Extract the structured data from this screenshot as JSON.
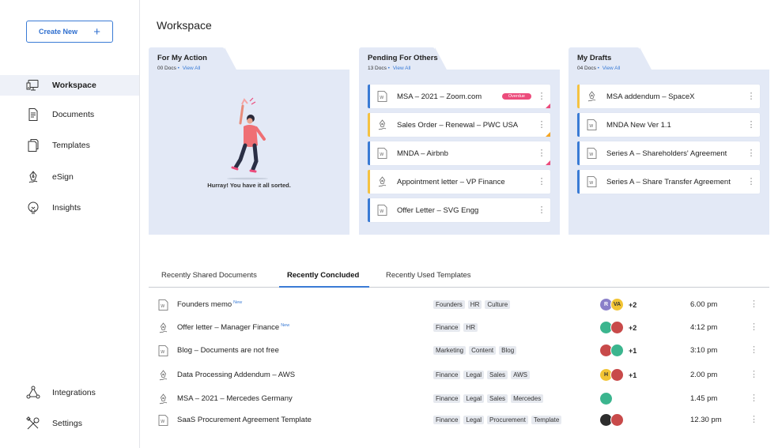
{
  "sidebar": {
    "create_label": "Create New",
    "create_icon": "plus-icon",
    "nav_top": [
      {
        "label": "Workspace",
        "icon": "monitor-icon",
        "active": true
      },
      {
        "label": "Documents",
        "icon": "document-icon",
        "active": false
      },
      {
        "label": "Templates",
        "icon": "templates-icon",
        "active": false
      },
      {
        "label": "eSign",
        "icon": "pen-nib-icon",
        "active": false
      },
      {
        "label": "Insights",
        "icon": "lightbulb-icon",
        "active": false
      }
    ],
    "nav_bottom": [
      {
        "label": "Integrations",
        "icon": "integrations-icon"
      },
      {
        "label": "Settings",
        "icon": "settings-tools-icon"
      }
    ]
  },
  "header": {
    "title": "Workspace"
  },
  "panels": {
    "my_action": {
      "title": "For My Action",
      "count": "00 Docs",
      "sep": "•",
      "view_all": "View All",
      "empty_text": "Hurray! You have it all sorted."
    },
    "pending": {
      "title": "Pending For Others",
      "count": "13 Docs",
      "sep": "•",
      "view_all": "View All",
      "docs": [
        {
          "name": "MSA – 2021 – Zoom.com",
          "icon": "word-doc-icon",
          "border": "blue",
          "badge": "Overdue",
          "corner": "pink"
        },
        {
          "name": "Sales Order – Renewal – PWC USA",
          "icon": "pen-nib-icon",
          "border": "yellow",
          "corner": "orange"
        },
        {
          "name": "MNDA – Airbnb",
          "icon": "word-doc-icon",
          "border": "blue",
          "corner": "pink"
        },
        {
          "name": "Appointment letter – VP Finance",
          "icon": "pen-nib-icon",
          "border": "yellow"
        },
        {
          "name": "Offer Letter – SVG Engg",
          "icon": "word-doc-icon",
          "border": "blue"
        }
      ]
    },
    "drafts": {
      "title": "My Drafts",
      "count": "04 Docs",
      "sep": "•",
      "view_all": "View All",
      "docs": [
        {
          "name": "MSA addendum – SpaceX",
          "icon": "pen-nib-icon",
          "border": "yellow"
        },
        {
          "name": "MNDA New Ver 1.1",
          "icon": "word-doc-icon",
          "border": "blue"
        },
        {
          "name": "Series A – Shareholders' Agreement",
          "icon": "word-doc-icon",
          "border": "blue"
        },
        {
          "name": "Series A – Share Transfer Agreement",
          "icon": "word-doc-icon",
          "border": "blue"
        }
      ]
    }
  },
  "tabs": [
    {
      "label": "Recently Shared Documents",
      "active": false
    },
    {
      "label": "Recently Concluded",
      "active": true
    },
    {
      "label": "Recently Used Templates",
      "active": false
    }
  ],
  "rows": [
    {
      "name": "Founders memo",
      "new": "New",
      "icon": "word-doc-icon",
      "tags": [
        "Founders",
        "HR",
        "Culture"
      ],
      "avatars": [
        "R",
        "VA"
      ],
      "more": "+2",
      "time": "6.00 pm"
    },
    {
      "name": "Offer letter – Manager Finance",
      "new": "New",
      "icon": "pen-nib-icon",
      "tags": [
        "Finance",
        "HR"
      ],
      "avatars": [
        "",
        ""
      ],
      "more": "+2",
      "time": "4:12 pm"
    },
    {
      "name": "Blog – Documents are not free",
      "new": "",
      "icon": "word-doc-icon",
      "tags": [
        "Marketing",
        "Content",
        "Blog"
      ],
      "avatars": [
        "",
        ""
      ],
      "more": "+1",
      "time": "3:10 pm"
    },
    {
      "name": "Data Processing Addendum – AWS",
      "new": "",
      "icon": "pen-nib-icon",
      "tags": [
        "Finance",
        "Legal",
        "Sales",
        "AWS"
      ],
      "avatars": [
        "H",
        ""
      ],
      "more": "+1",
      "time": "2.00 pm"
    },
    {
      "name": "MSA – 2021 – Mercedes Germany",
      "new": "",
      "icon": "pen-nib-icon",
      "tags": [
        "Finance",
        "Legal",
        "Sales",
        "Mercedes"
      ],
      "avatars": [
        ""
      ],
      "more": "",
      "time": "1.45 pm"
    },
    {
      "name": "SaaS Procurement Agreement Template",
      "new": "",
      "icon": "word-doc-icon",
      "tags": [
        "Finance",
        "Legal",
        "Procurement",
        "Template"
      ],
      "avatars": [
        "",
        ""
      ],
      "more": "",
      "time": "12.30 pm"
    }
  ],
  "colors": {
    "accent": "#3a7bd5",
    "panel_bg": "#e3e9f6",
    "overdue": "#ec4c7c",
    "pending_yellow": "#f5c242"
  }
}
